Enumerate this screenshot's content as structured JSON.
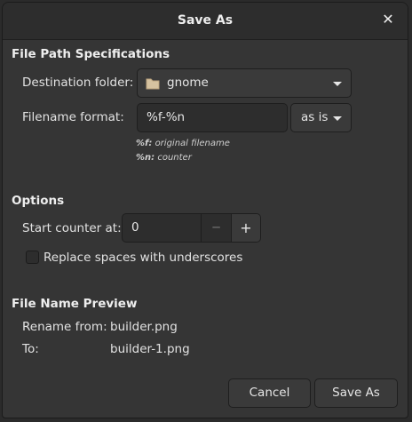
{
  "window": {
    "title": "Save As",
    "close_glyph": "✕"
  },
  "file_path": {
    "heading": "File Path Specifications",
    "destination_label": "Destination folder:",
    "destination_value": "gnome",
    "filename_label": "Filename format:",
    "filename_value": "%f-%n",
    "case_value": "as is",
    "hint_f_key": "%f:",
    "hint_f_text": "original filename",
    "hint_n_key": "%n:",
    "hint_n_text": "counter"
  },
  "options": {
    "heading": "Options",
    "start_counter_label": "Start counter at:",
    "start_counter_value": "0",
    "decrement_glyph": "−",
    "increment_glyph": "+",
    "replace_spaces_label": "Replace spaces with underscores",
    "replace_spaces_checked": false
  },
  "preview": {
    "heading": "File Name Preview",
    "rename_from_label": "Rename from:",
    "rename_from_value": "builder.png",
    "to_label": "To:",
    "to_value": "builder-1.png"
  },
  "actions": {
    "cancel_label": "Cancel",
    "save_label": "Save As"
  },
  "icons": {
    "folder": "folder-icon",
    "dropdown": "chevron-down-icon",
    "close": "close-icon"
  },
  "colors": {
    "background": "#353535",
    "titlebar": "#2d2d2d",
    "button": "#3a3a3a",
    "folder": "#d6c2a0"
  }
}
